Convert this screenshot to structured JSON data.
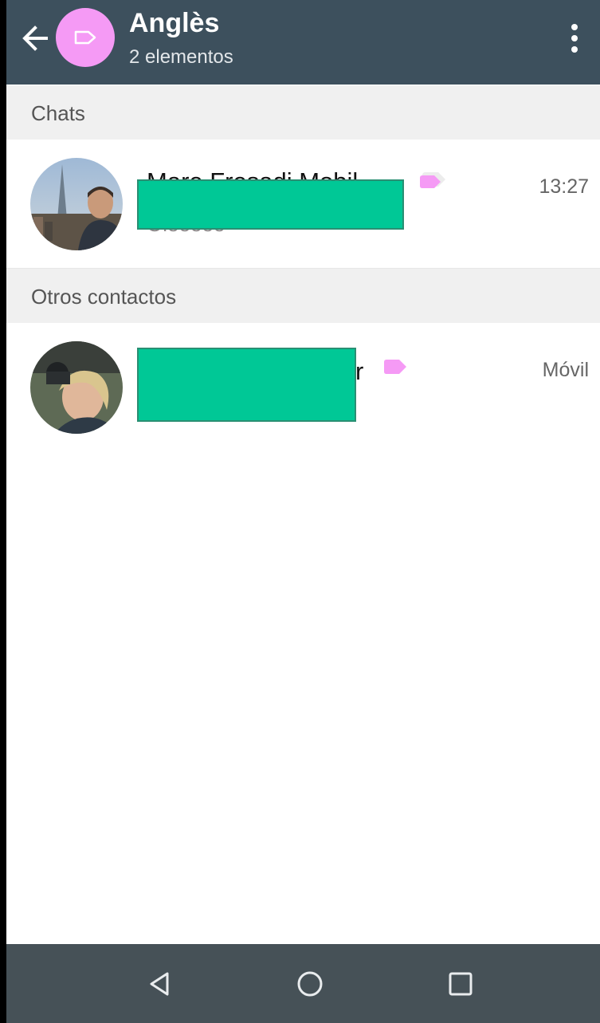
{
  "header": {
    "title": "Anglès",
    "subtitle": "2 elementos",
    "label_color": "#f59af5",
    "bar_color": "#3d505d"
  },
  "sections": [
    {
      "label": "Chats",
      "items": [
        {
          "name": "Mare Fresadi Mobil",
          "preview": "Oleeeee",
          "time": "13:27",
          "tag_color": "#f59af5",
          "redacted": true
        }
      ]
    },
    {
      "label": "Otros contactos",
      "items": [
        {
          "name": "r",
          "meta": "Móvil",
          "tag_color": "#f59af5",
          "redacted": true
        }
      ]
    }
  ],
  "icons": {
    "back": "arrow-left-icon",
    "label": "label-icon",
    "menu": "more-vertical-icon",
    "tag": "label-tag-icon",
    "nav_back": "triangle-back-icon",
    "nav_home": "circle-home-icon",
    "nav_recent": "square-recents-icon"
  },
  "redaction_color": "#00c896"
}
